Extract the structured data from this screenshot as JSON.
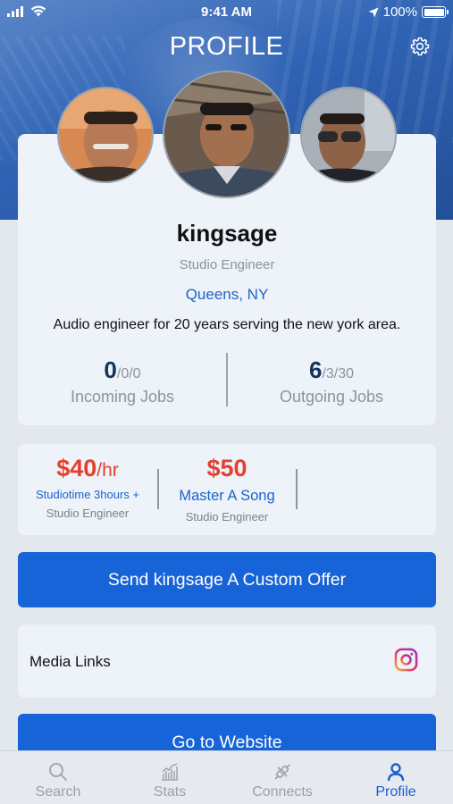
{
  "status_bar": {
    "time": "9:41 AM",
    "battery": "100%"
  },
  "header": {
    "title": "PROFILE"
  },
  "profile": {
    "username": "kingsage",
    "role": "Studio Engineer",
    "location": "Queens, NY",
    "bio": "Audio engineer for 20 years serving the new york area."
  },
  "jobs": {
    "incoming": {
      "count": "0",
      "detail": "/0/0",
      "label": "Incoming Jobs"
    },
    "outgoing": {
      "count": "6",
      "detail": "/3/30",
      "label": "Outgoing Jobs"
    }
  },
  "services": [
    {
      "price": "$40",
      "unit": "/hr",
      "name": "Studiotime 3hours +",
      "type": "Studio Engineer"
    },
    {
      "price": "$50",
      "unit": "",
      "name": "Master A Song",
      "type": "Studio Engineer"
    }
  ],
  "actions": {
    "custom_offer": "Send kingsage A Custom Offer",
    "website": "Go to Website"
  },
  "media": {
    "label": "Media Links",
    "icon": "instagram-icon"
  },
  "tabbar": {
    "search": "Search",
    "stats": "Stats",
    "connects": "Connects",
    "profile": "Profile",
    "active": "profile"
  },
  "colors": {
    "accent": "#1764d8",
    "price": "#e2412f",
    "link": "#1d63c9"
  }
}
